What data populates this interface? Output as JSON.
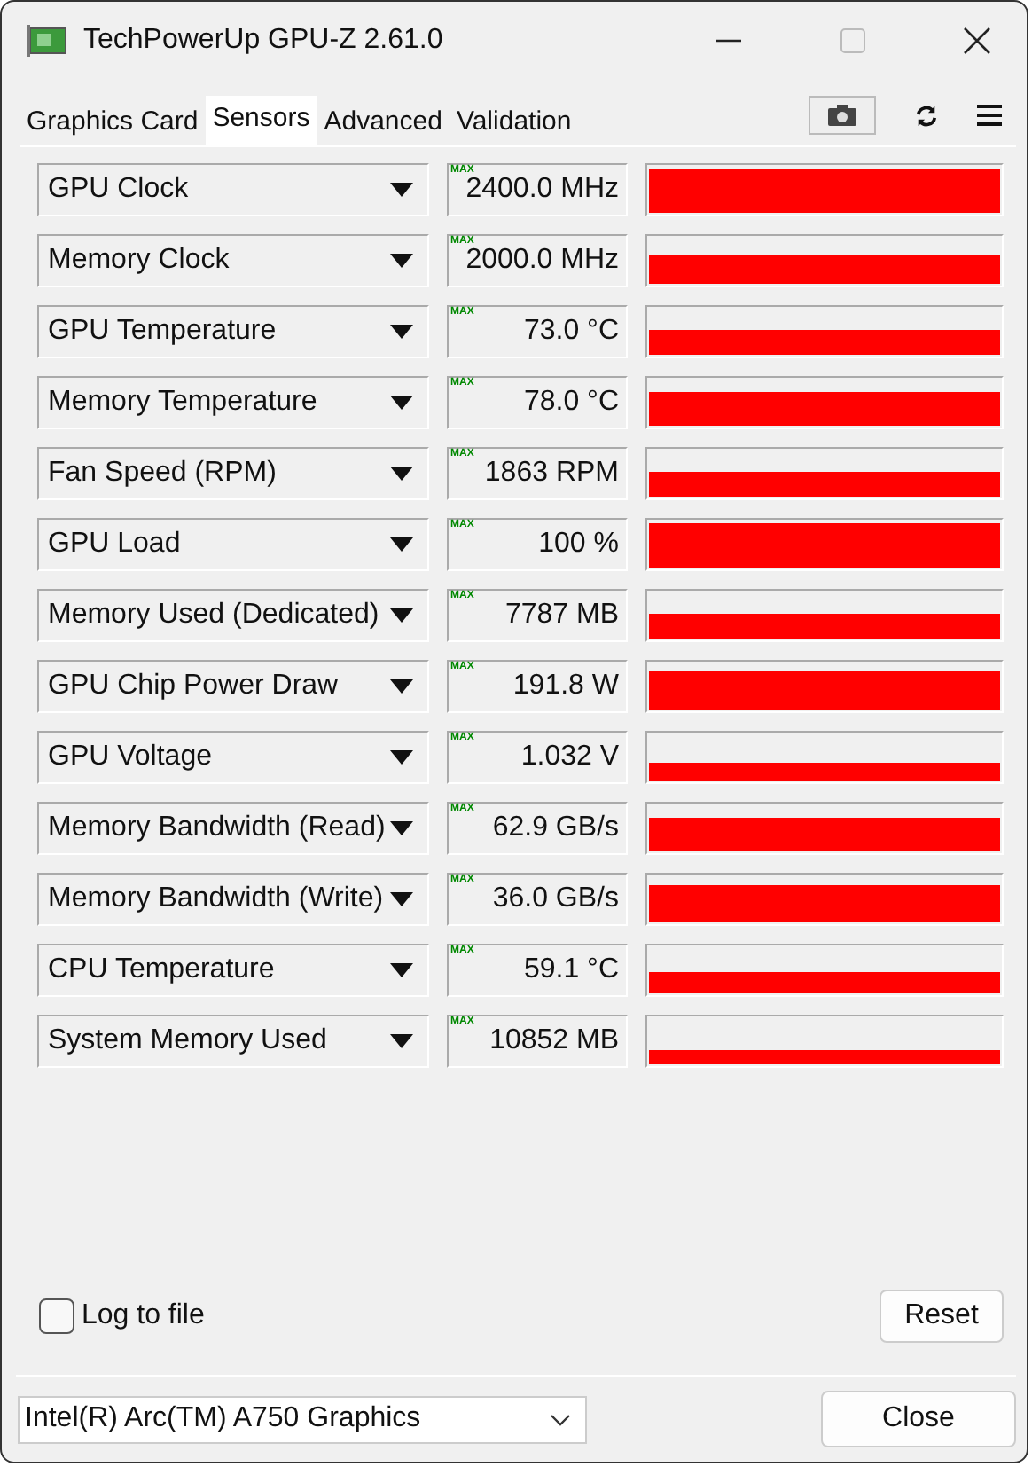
{
  "window": {
    "title": "TechPowerUp GPU-Z 2.61.0"
  },
  "tabs": [
    {
      "label": "Graphics Card",
      "selected": false
    },
    {
      "label": "Sensors",
      "selected": true
    },
    {
      "label": "Advanced",
      "selected": false
    },
    {
      "label": "Validation",
      "selected": false
    }
  ],
  "sensors": [
    {
      "name": "GPU Clock",
      "badge": "MAX",
      "value": "2400.0 MHz"
    },
    {
      "name": "Memory Clock",
      "badge": "MAX",
      "value": "2000.0 MHz"
    },
    {
      "name": "GPU Temperature",
      "badge": "MAX",
      "value": "73.0 °C"
    },
    {
      "name": "Memory Temperature",
      "badge": "MAX",
      "value": "78.0 °C"
    },
    {
      "name": "Fan Speed (RPM)",
      "badge": "MAX",
      "value": "1863 RPM"
    },
    {
      "name": "GPU Load",
      "badge": "MAX",
      "value": "100 %"
    },
    {
      "name": "Memory Used (Dedicated)",
      "badge": "MAX",
      "value": "7787 MB"
    },
    {
      "name": "GPU Chip Power Draw",
      "badge": "MAX",
      "value": "191.8 W"
    },
    {
      "name": "GPU Voltage",
      "badge": "MAX",
      "value": "1.032 V"
    },
    {
      "name": "Memory Bandwidth (Read)",
      "badge": "MAX",
      "value": "62.9 GB/s"
    },
    {
      "name": "Memory Bandwidth (Write)",
      "badge": "MAX",
      "value": "36.0 GB/s"
    },
    {
      "name": "CPU Temperature",
      "badge": "MAX",
      "value": "59.1 °C"
    },
    {
      "name": "System Memory Used",
      "badge": "MAX",
      "value": "10852 MB"
    }
  ],
  "log_to_file": {
    "label": "Log to file",
    "checked": false
  },
  "reset_button": "Reset",
  "device_select": {
    "value": "Intel(R) Arc(TM) A750 Graphics"
  },
  "close_button": "Close"
}
